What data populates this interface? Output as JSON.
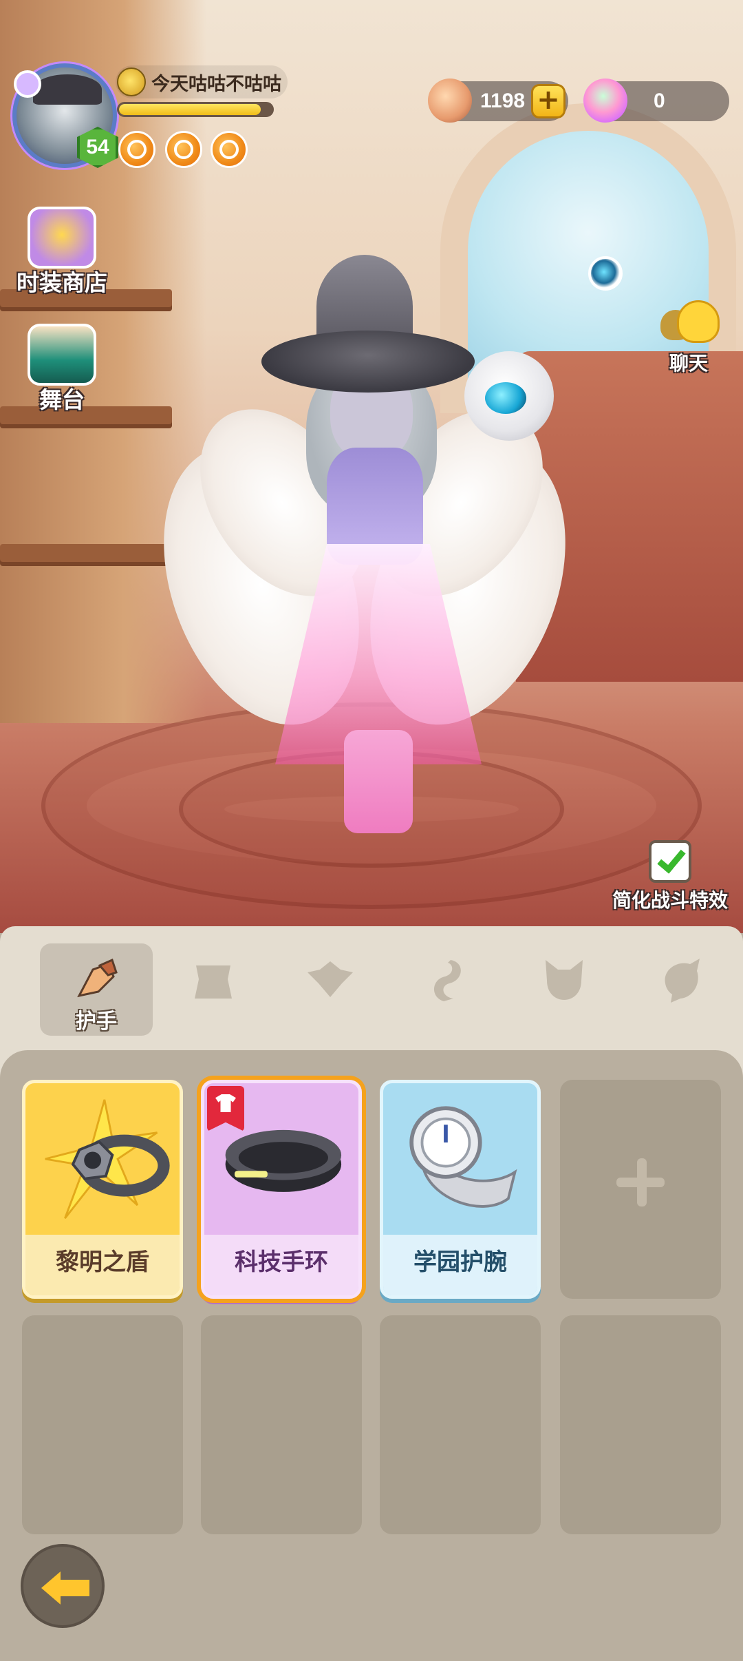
{
  "player": {
    "name": "今天咕咕不咕咕",
    "level": "54",
    "exp_progress": 0.93
  },
  "currency": {
    "shells": "1198",
    "gems": "0"
  },
  "side_menu": {
    "fashion_shop": "时装商店",
    "stage": "舞台",
    "chat": "聊天"
  },
  "simplify_effects": {
    "label": "简化战斗特效",
    "checked": true
  },
  "tabs": [
    {
      "label": "护手",
      "icon": "gauntlet-icon",
      "active": true
    },
    {
      "label": "",
      "icon": "armor-icon",
      "active": false
    },
    {
      "label": "",
      "icon": "emblem-icon",
      "active": false
    },
    {
      "label": "",
      "icon": "tail-icon",
      "active": false
    },
    {
      "label": "",
      "icon": "pet-icon",
      "active": false
    },
    {
      "label": "",
      "icon": "aura-icon",
      "active": false
    }
  ],
  "items": [
    {
      "name": "黎明之盾",
      "rarity_color": "#fdd24c",
      "new": false,
      "selected": false
    },
    {
      "name": "科技手环",
      "rarity_color": "#e6b8f0",
      "new": true,
      "selected": true
    },
    {
      "name": "学园护腕",
      "rarity_color": "#a9dcf1",
      "new": false,
      "selected": false
    }
  ],
  "colors": {
    "accent": "#f5a21d",
    "check": "#39b82d",
    "tag_red": "#e2283c"
  }
}
